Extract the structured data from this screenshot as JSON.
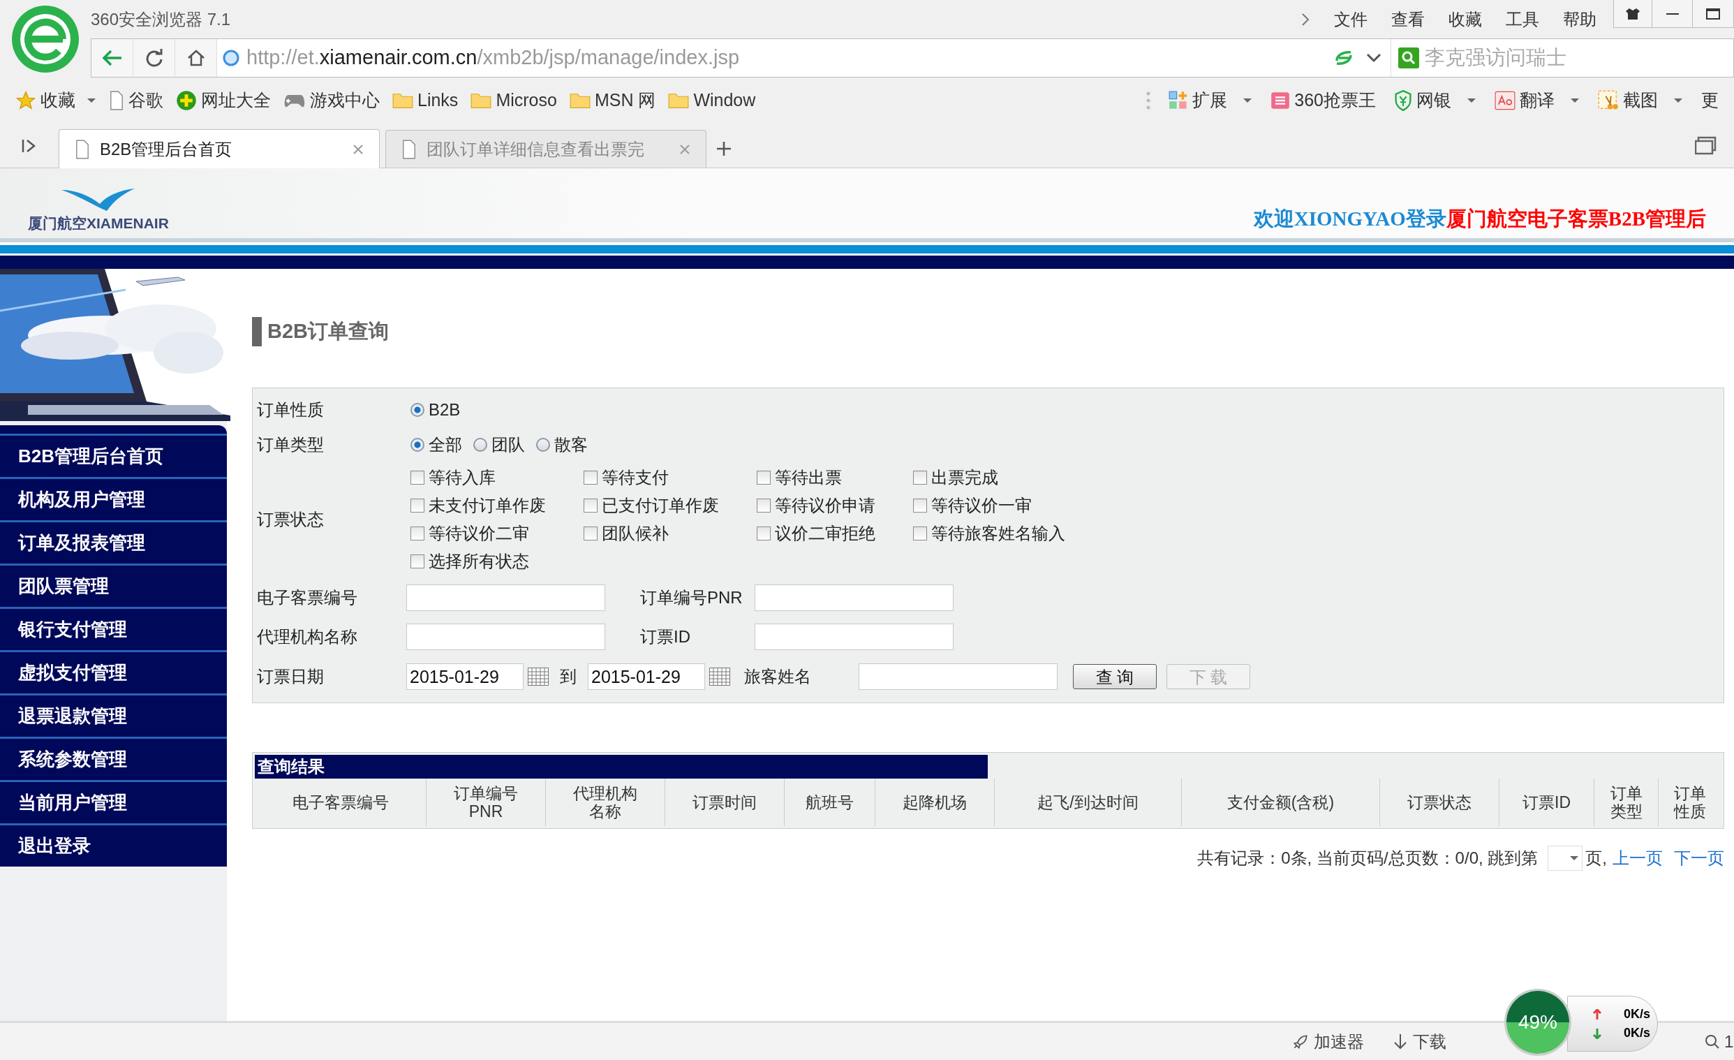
{
  "browser": {
    "title": "360安全浏览器 7.1",
    "menu": [
      "文件",
      "查看",
      "收藏",
      "工具",
      "帮助"
    ],
    "url": {
      "scheme": "http://et.",
      "domain": "xiamenair.com.cn",
      "path": "/xmb2b/jsp/manage/index.jsp"
    },
    "search": {
      "placeholder": "李克强访问瑞士"
    },
    "bookmarks": [
      {
        "kind": "star",
        "label": "收藏"
      },
      {
        "kind": "page",
        "label": "谷歌"
      },
      {
        "kind": "plus",
        "label": "网址大全"
      },
      {
        "kind": "game",
        "label": "游戏中心"
      },
      {
        "kind": "folder",
        "label": "Links"
      },
      {
        "kind": "folder",
        "label": "Microso"
      },
      {
        "kind": "folder",
        "label": "MSN 网"
      },
      {
        "kind": "folder",
        "label": "Window"
      }
    ],
    "extensions": [
      {
        "kind": "grid",
        "label": "扩展",
        "dropdown": true
      },
      {
        "kind": "ticket",
        "label": "360抢票王",
        "dropdown": false
      },
      {
        "kind": "shield",
        "label": "网银",
        "dropdown": true
      },
      {
        "kind": "translate",
        "label": "翻译",
        "dropdown": true
      },
      {
        "kind": "scissors",
        "label": "截图",
        "dropdown": true
      },
      {
        "kind": "none",
        "label": "更",
        "dropdown": false
      }
    ],
    "tabs": [
      {
        "label": "B2B管理后台首页",
        "selected": true
      },
      {
        "label": "团队订单详细信息查看出票完",
        "selected": false
      }
    ]
  },
  "header": {
    "logo": "厦门航空XIAMENAIR",
    "welcome": "欢迎XIONGYAO登录",
    "system": "厦门航空电子客票B2B管理后"
  },
  "sidebar": {
    "items": [
      "B2B管理后台首页",
      "机构及用户管理",
      "订单及报表管理",
      "团队票管理",
      "银行支付管理",
      "虚拟支付管理",
      "退票退款管理",
      "系统参数管理",
      "当前用户管理",
      "退出登录"
    ]
  },
  "form": {
    "title": "B2B订单查询",
    "order_nature": {
      "label": "订单性质",
      "options": [
        {
          "label": "B2B",
          "selected": true
        }
      ]
    },
    "order_type": {
      "label": "订单类型",
      "options": [
        {
          "label": "全部",
          "selected": true
        },
        {
          "label": "团队",
          "selected": false
        },
        {
          "label": "散客",
          "selected": false
        }
      ]
    },
    "ticket_status": {
      "label": "订票状态",
      "options": [
        {
          "label": "等待入库",
          "checked": false
        },
        {
          "label": "等待支付",
          "checked": false
        },
        {
          "label": "等待出票",
          "checked": false
        },
        {
          "label": "出票完成",
          "checked": false
        },
        {
          "label": "未支付订单作废",
          "checked": false
        },
        {
          "label": "已支付订单作废",
          "checked": false
        },
        {
          "label": "等待议价申请",
          "checked": false
        },
        {
          "label": "等待议价一审",
          "checked": false
        },
        {
          "label": "等待议价二审",
          "checked": false
        },
        {
          "label": "团队候补",
          "checked": false
        },
        {
          "label": "议价二审拒绝",
          "checked": false
        },
        {
          "label": "等待旅客姓名输入",
          "checked": false
        },
        {
          "label": "选择所有状态",
          "checked": false
        }
      ]
    },
    "eticket_no": {
      "label": "电子客票编号"
    },
    "pnr": {
      "label": "订单编号PNR"
    },
    "agency": {
      "label": "代理机构名称"
    },
    "order_id": {
      "label": "订票ID"
    },
    "date": {
      "label": "订票日期",
      "from": "2015-01-29",
      "to_label": "到",
      "to": "2015-01-29"
    },
    "passenger": {
      "label": "旅客姓名"
    },
    "buttons": [
      {
        "label": "查 询",
        "disabled": false
      },
      {
        "label": "下 载",
        "disabled": true
      }
    ]
  },
  "results": {
    "title": "查询结果",
    "columns": [
      "电子客票编号",
      "订单编号PNR",
      "代理机构名称",
      "订票时间",
      "航班号",
      "起降机场",
      "起飞/到达时间",
      "支付金额(含税)",
      "订票状态",
      "订票ID",
      "订单类型",
      "订单性质"
    ],
    "pagination": {
      "summary": "共有记录：0条, 当前页码/总页数：0/0, 跳到第",
      "page_suffix": "页,",
      "prev": "上一页",
      "next": "下一页"
    }
  },
  "status_bar": {
    "items": [
      {
        "kind": "rocket",
        "label": "加速器"
      },
      {
        "kind": "download",
        "label": "下载"
      }
    ],
    "zoom": "1"
  },
  "speed_widget": {
    "percent": "49%",
    "up": "0K/s",
    "down": "0K/s"
  }
}
